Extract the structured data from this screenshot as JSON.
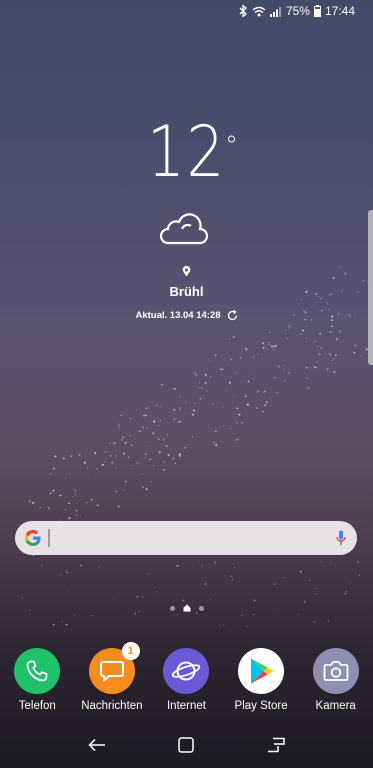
{
  "status_bar": {
    "battery": "75%",
    "time": "17:44",
    "icons": [
      "bluetooth-icon",
      "wifi-icon",
      "signal-icon",
      "battery-icon"
    ]
  },
  "weather": {
    "temperature": "12",
    "degree_symbol": "°",
    "condition_icon": "cloud-icon",
    "location": "Brühl",
    "updated": "Aktual. 13.04 14:28"
  },
  "search": {
    "logo": "google-g-icon",
    "mic_icon": "mic-icon"
  },
  "dock": {
    "apps": [
      {
        "label": "Telefon",
        "color": "#1fc26b",
        "icon": "phone-icon"
      },
      {
        "label": "Nachrichten",
        "color": "#f58d1e",
        "icon": "message-icon",
        "badge": "1"
      },
      {
        "label": "Internet",
        "color": "#6a5ad8",
        "icon": "planet-icon"
      },
      {
        "label": "Play Store",
        "color": "#ffffff",
        "icon": "play-store-icon"
      },
      {
        "label": "Kamera",
        "color": "#8f8fb2",
        "icon": "camera-icon"
      }
    ]
  },
  "navigation": [
    "back-icon",
    "home-icon",
    "recents-icon"
  ]
}
